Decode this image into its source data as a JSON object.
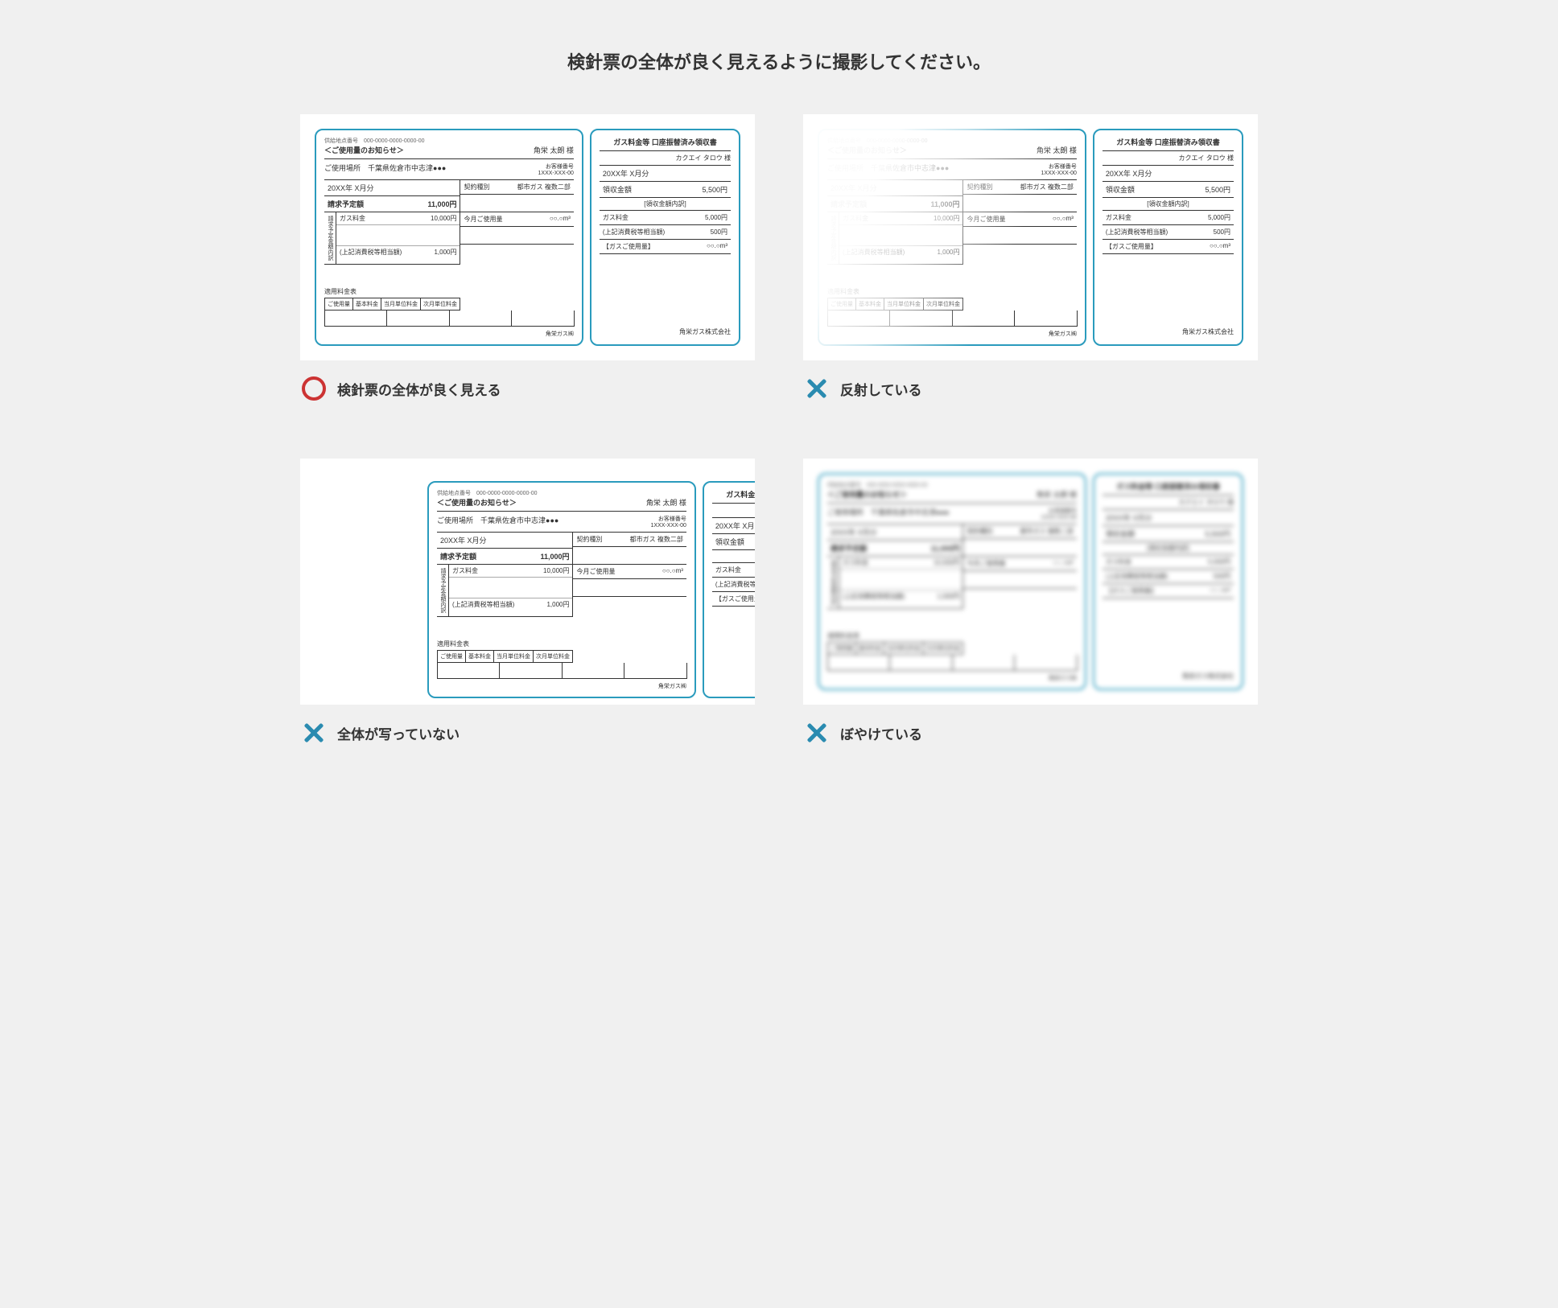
{
  "title": "検針票の全体が良く見えるように撮影してください。",
  "captions": {
    "good": "検針票の全体が良く見える",
    "glare": "反射している",
    "cropped": "全体が写っていない",
    "blurry": "ぼやけている"
  },
  "slip": {
    "supply_point_label": "供給地点番号",
    "supply_point_no": "000-0000-0000-0000-00",
    "notice_title": "＜ご使用量のお知らせ＞",
    "customer_name": "角栄 太朗 様",
    "usage_loc_label": "ご使用場所",
    "usage_loc": "千葉県佐倉市中志津●●●",
    "cust_no_label": "お客様番号",
    "cust_no": "1XXX-XXX-00",
    "month_label": "20XX年 X月分",
    "contract_type_label": "契約種別",
    "contract_type": "都市ガス 複数二部",
    "bill_due_label": "請求予定額",
    "bill_due_value": "11,000円",
    "breakdown_label": "請求予定金額内訳",
    "gas_fee_label": "ガス料金",
    "gas_fee_value": "10,000円",
    "tax_note": "(上記消費税等相当額)",
    "tax_value": "1,000円",
    "usage_this_month_label": "今月ご使用量",
    "usage_this_month_value": "○○.○m³",
    "tariff_title": "適用料金表",
    "tariff_cols": [
      "ご使用量",
      "基本料金",
      "当月単位料金",
      "次月単位料金"
    ],
    "company": "角栄ガス㈱"
  },
  "receipt": {
    "title": "ガス料金等 口座振替済み領収書",
    "kana_name": "カクエイ タロウ 様",
    "month": "20XX年 X月分",
    "amount_label": "領収金額",
    "amount_value": "5,500円",
    "breakdown_header": "[領収金額内訳]",
    "gas_fee_label": "ガス料金",
    "gas_fee_value": "5,000円",
    "tax_note": "(上記消費税等相当額)",
    "tax_value": "500円",
    "usage_label": "【ガスご使用量】",
    "usage_value": "○○.○m³",
    "company": "角栄ガス株式会社"
  }
}
